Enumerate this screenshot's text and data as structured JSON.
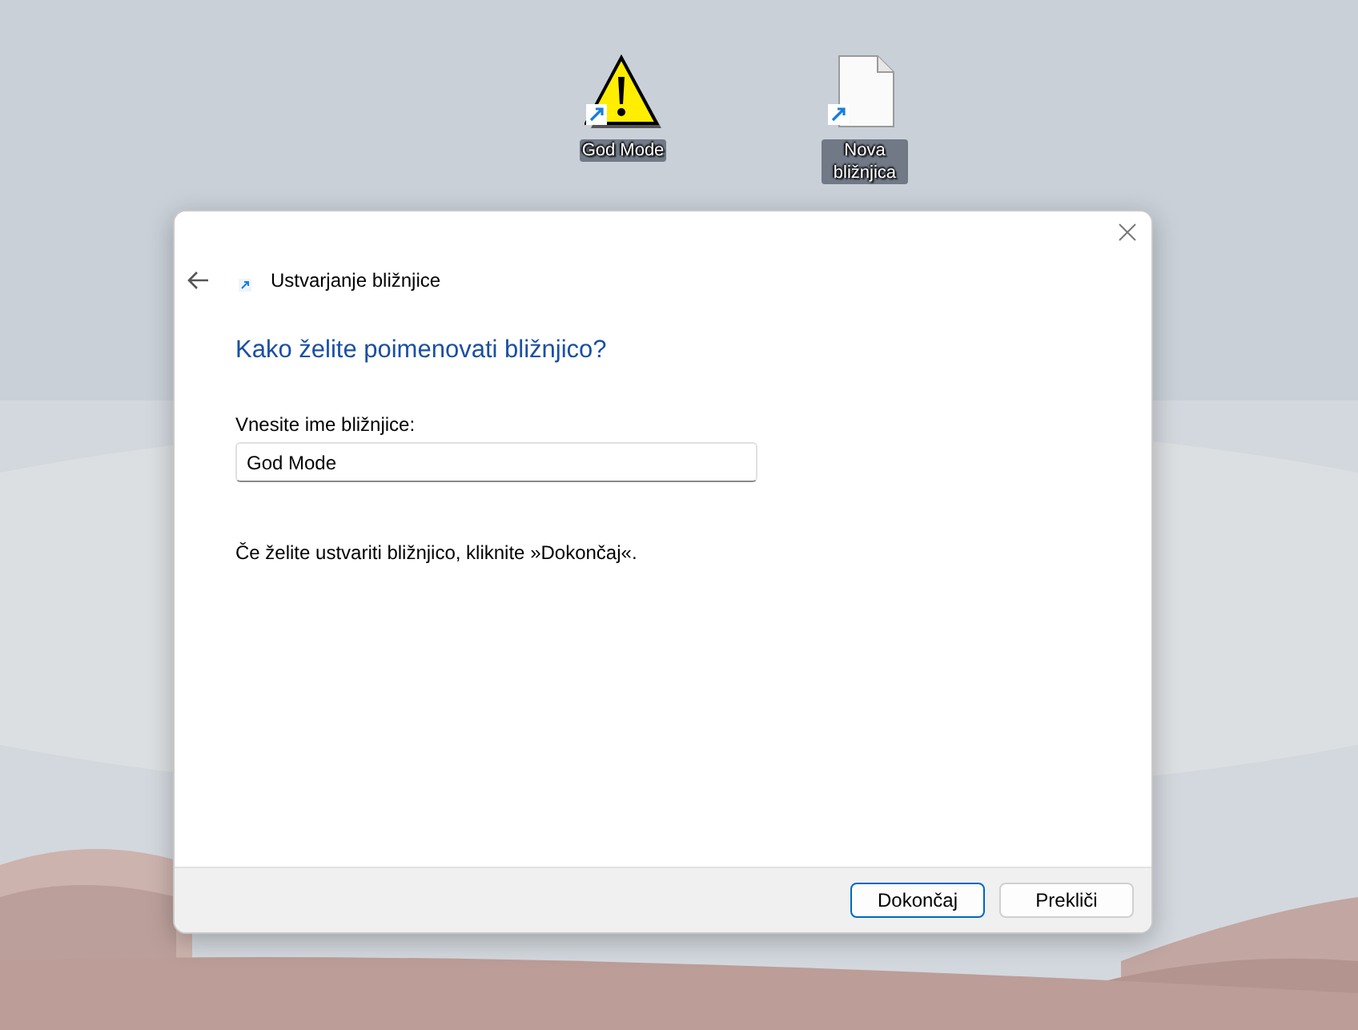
{
  "desktop": {
    "icons": [
      {
        "label": "God Mode",
        "kind": "warning"
      },
      {
        "label": "Nova bližnjica",
        "kind": "file"
      }
    ]
  },
  "dialog": {
    "title": "Ustvarjanje bližnjice",
    "heading": "Kako želite poimenovati bližnjico?",
    "field": {
      "label": "Vnesite ime bližnjice:",
      "value": "God Mode"
    },
    "instruction": "Če želite ustvariti bližnjico, kliknite »Dokončaj«.",
    "buttons": [
      {
        "label": "Dokončaj",
        "default": true
      },
      {
        "label": "Prekliči",
        "default": false
      }
    ]
  }
}
